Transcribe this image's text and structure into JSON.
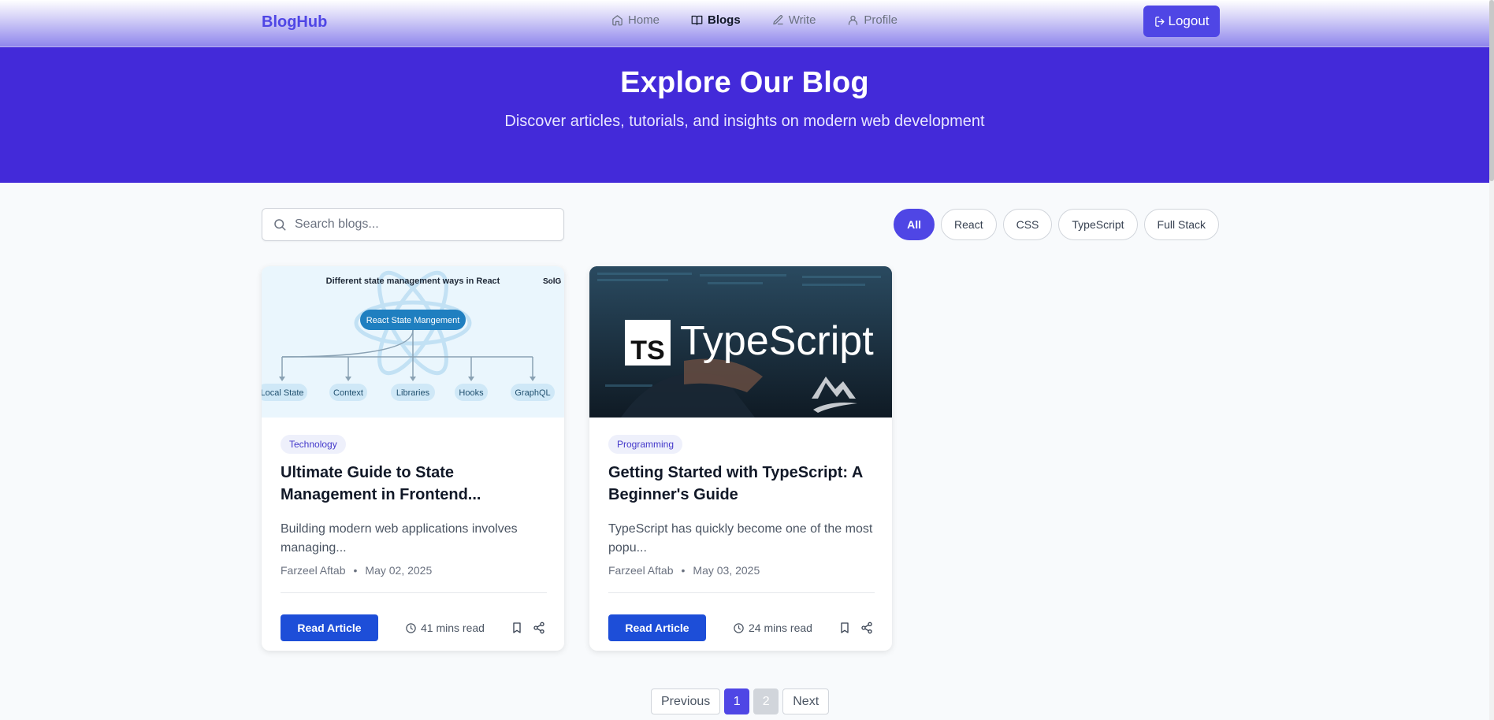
{
  "nav": {
    "brand": "BlogHub",
    "links": [
      {
        "label": "Home",
        "icon": "home-icon",
        "active": false
      },
      {
        "label": "Blogs",
        "icon": "book-open-icon",
        "active": true
      },
      {
        "label": "Write",
        "icon": "pen-icon",
        "active": false
      },
      {
        "label": "Profile",
        "icon": "user-icon",
        "active": false
      }
    ],
    "logout_label": "Logout"
  },
  "hero": {
    "title": "Explore Our Blog",
    "subtitle": "Discover articles, tutorials, and insights on modern web development"
  },
  "search": {
    "placeholder": "Search blogs..."
  },
  "filters": [
    {
      "label": "All",
      "active": true
    },
    {
      "label": "React",
      "active": false
    },
    {
      "label": "CSS",
      "active": false
    },
    {
      "label": "TypeScript",
      "active": false
    },
    {
      "label": "Full Stack",
      "active": false
    }
  ],
  "cards": [
    {
      "image": {
        "heading": "Different state management ways in React",
        "brand_mark": "SolG",
        "center_node": "React State Mangement",
        "leaf_nodes": [
          "Local State",
          "Context",
          "Libraries",
          "Hooks",
          "GraphQL"
        ]
      },
      "category": "Technology",
      "title": "Ultimate Guide to State Management in Frontend...",
      "excerpt": "Building modern web applications involves managing...",
      "author": "Farzeel Aftab",
      "date": "May 02, 2025",
      "read_label": "Read Article",
      "read_time": "41 mins read"
    },
    {
      "image": {
        "logo_badge": "TS",
        "logo_text": "TypeScript"
      },
      "category": "Programming",
      "title": "Getting Started with TypeScript: A Beginner's Guide",
      "excerpt": "TypeScript has quickly become one of the most popu...",
      "author": "Farzeel Aftab",
      "date": "May 03, 2025",
      "read_label": "Read Article",
      "read_time": "24 mins read"
    }
  ],
  "meta_separator": "•",
  "pagination": {
    "previous": "Previous",
    "pages": [
      "1",
      "2"
    ],
    "current": "1",
    "next": "Next"
  },
  "colors": {
    "primary": "#4f46e5",
    "hero_bg": "#432ad9",
    "read_button": "#1d4ed8"
  }
}
